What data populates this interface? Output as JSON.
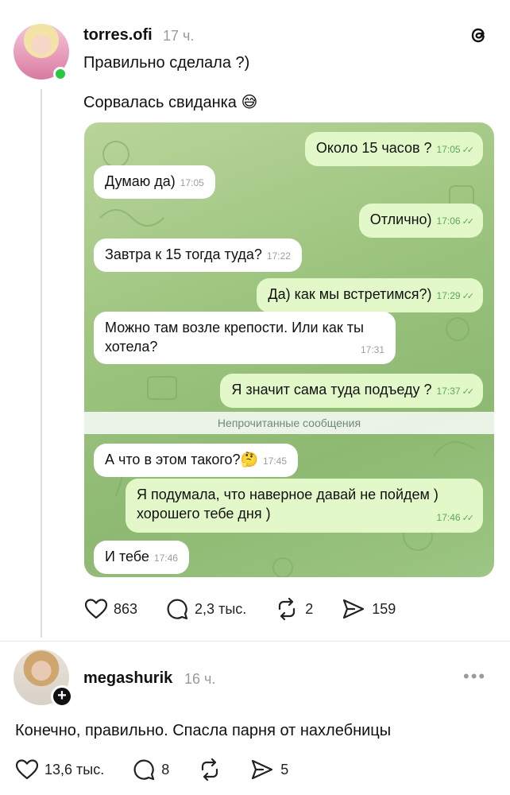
{
  "post": {
    "username": "torres.ofi",
    "time": "17 ч.",
    "text1": "Правильно сделала ?)",
    "text2": "Сорвалась свиданка 😅",
    "chat": {
      "messages": [
        {
          "dir": "out",
          "text": "Около 15 часов ?",
          "time": "17:05"
        },
        {
          "dir": "in",
          "text": "Думаю да)",
          "time": "17:05"
        },
        {
          "dir": "out",
          "text": "Отлично)",
          "time": "17:06"
        },
        {
          "dir": "in",
          "text": "Завтра к 15 тогда туда?",
          "time": "17:22"
        },
        {
          "dir": "out",
          "text": "Да) как мы встретимся?)",
          "time": "17:29"
        },
        {
          "dir": "in",
          "text": "Можно там возле крепости. Или как ты хотела?",
          "time": "17:31"
        },
        {
          "dir": "out",
          "text": "Я значит сама туда подъеду ?",
          "time": "17:37"
        },
        {
          "dir": "in",
          "text": "А что в этом такого?🤔",
          "time": "17:45"
        },
        {
          "dir": "out",
          "text": "Я подумала, что наверное давай не пойдем ) хорошего тебе дня )",
          "time": "17:46"
        },
        {
          "dir": "in",
          "text": "И тебе",
          "time": "17:46"
        }
      ],
      "unread_label": "Непрочитанные сообщения"
    },
    "actions": {
      "likes": "863",
      "comments": "2,3 тыс.",
      "reposts": "2",
      "shares": "159"
    }
  },
  "reply": {
    "username": "megashurik",
    "time": "16 ч.",
    "text": "Конечно, правильно. Спасла парня от нахлебницы",
    "actions": {
      "likes": "13,6 тыс.",
      "comments": "8",
      "shares": "5"
    }
  },
  "icons": {
    "logo": "threads-logo-icon",
    "like": "heart-icon",
    "comment": "comment-icon",
    "repost": "repost-icon",
    "share": "send-icon",
    "more": "more-icon",
    "follow": "plus-icon"
  },
  "colors": {
    "accent_online": "#27c93f",
    "chat_outgoing": "#e3f8c8",
    "chat_bg": "#9cc47e"
  }
}
